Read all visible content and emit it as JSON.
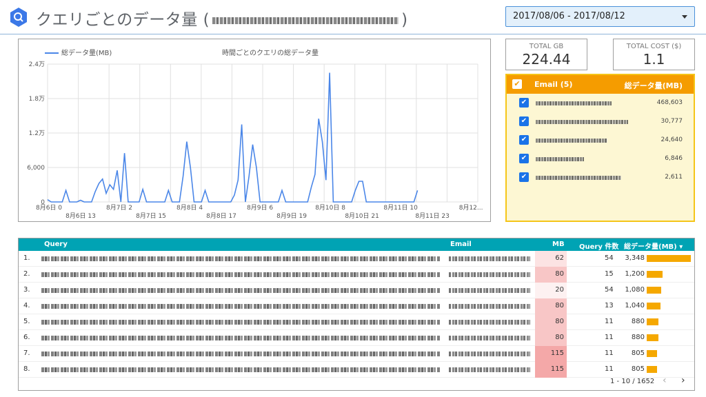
{
  "header": {
    "title": "クエリごとのデータ量 (",
    "title_end": ")",
    "date_range": "2017/08/06 - 2017/08/12"
  },
  "kpis": [
    {
      "label": "TOTAL GB",
      "value": "224.44"
    },
    {
      "label": "TOTAL COST ($)",
      "value": "1.1"
    }
  ],
  "chart_data": {
    "type": "line",
    "title": "時間ごとのクエリの総データ量",
    "series": [
      {
        "name": "総データ量(MB)",
        "color": "#4a86e8",
        "values": [
          400,
          0,
          0,
          0,
          0,
          2000,
          0,
          0,
          0,
          300,
          0,
          0,
          0,
          1800,
          3200,
          4000,
          1500,
          3000,
          2200,
          5500,
          0,
          8500,
          0,
          0,
          0,
          0,
          2200,
          0,
          0,
          0,
          0,
          0,
          0,
          2000,
          0,
          0,
          0,
          4500,
          10500,
          6000,
          0,
          0,
          0,
          2000,
          0,
          0,
          0,
          0,
          0,
          0,
          0,
          1200,
          3800,
          13500,
          0,
          4500,
          10000,
          6000,
          0,
          0,
          0,
          0,
          0,
          0,
          2000,
          0,
          0,
          0,
          0,
          0,
          0,
          0,
          2600,
          4800,
          14500,
          10500,
          3800,
          22500,
          0,
          0,
          0,
          0,
          0,
          0,
          2000,
          3600,
          3600,
          0,
          0,
          0,
          0,
          0,
          0,
          0,
          0,
          0,
          0,
          0,
          0,
          0,
          0,
          2000
        ]
      }
    ],
    "y_ticks": [
      "0",
      "6,000",
      "1.2万",
      "1.8万",
      "2.4万"
    ],
    "ylim": [
      0,
      24000
    ],
    "x_ticks_row1": [
      "8月6日 0",
      "8月7日 2",
      "8月8日 4",
      "8月9日 6",
      "8月10日 8",
      "8月11日 10",
      "8月12..."
    ],
    "x_ticks_row2": [
      "8月6日 13",
      "8月7日 15",
      "8月8日 17",
      "8月9日 19",
      "8月10日 21",
      "8月11日 23"
    ],
    "grid": true,
    "legend": "top-left"
  },
  "email_filter": {
    "col1": "Email (5)",
    "col2": "総データ量(MB)",
    "rows": [
      {
        "value": "468,603",
        "w": 110
      },
      {
        "value": "30,777",
        "w": 134
      },
      {
        "value": "24,640",
        "w": 104
      },
      {
        "value": "6,846",
        "w": 70
      },
      {
        "value": "2,611",
        "w": 124
      }
    ]
  },
  "table": {
    "headers": {
      "query": "Query",
      "email": "Email",
      "mb": "MB",
      "count": "Query 件数",
      "total": "総データ量(MB) ▾"
    },
    "rows": [
      {
        "n": "1.",
        "mb": "62",
        "count": "54",
        "total": "3,348",
        "share": 1.0,
        "tint": "#fce3e3"
      },
      {
        "n": "2.",
        "mb": "80",
        "count": "15",
        "total": "1,200",
        "share": 0.358,
        "tint": "#f8c6c6"
      },
      {
        "n": "3.",
        "mb": "20",
        "count": "54",
        "total": "1,080",
        "share": 0.323,
        "tint": "#fdf1f1"
      },
      {
        "n": "4.",
        "mb": "80",
        "count": "13",
        "total": "1,040",
        "share": 0.311,
        "tint": "#f8c6c6"
      },
      {
        "n": "5.",
        "mb": "80",
        "count": "11",
        "total": "880",
        "share": 0.263,
        "tint": "#f8c6c6"
      },
      {
        "n": "6.",
        "mb": "80",
        "count": "11",
        "total": "880",
        "share": 0.263,
        "tint": "#f8c6c6"
      },
      {
        "n": "7.",
        "mb": "115",
        "count": "11",
        "total": "805",
        "share": 0.24,
        "tint": "#f4a8a8"
      },
      {
        "n": "8.",
        "mb": "115",
        "count": "11",
        "total": "805",
        "share": 0.24,
        "tint": "#f4a8a8"
      }
    ],
    "pager": "1 - 10 / 1652"
  },
  "colors": {
    "accent": "#00a3b4",
    "bar": "#f5a800",
    "line": "#4a86e8",
    "filter_header": "#f59c00"
  }
}
